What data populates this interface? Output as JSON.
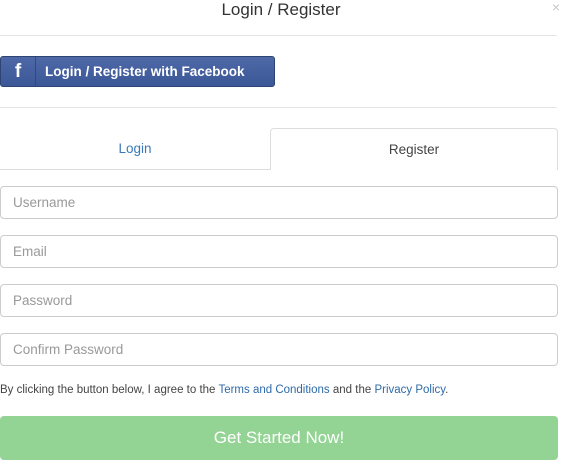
{
  "modal": {
    "title": "Login / Register",
    "close_glyph": "×"
  },
  "facebook": {
    "icon_glyph": "f",
    "label": "Login / Register with Facebook",
    "color": "#3b5797"
  },
  "tabs": [
    {
      "label": "Login",
      "active": false
    },
    {
      "label": "Register",
      "active": true
    }
  ],
  "fields": {
    "username": {
      "placeholder": "Username",
      "value": ""
    },
    "email": {
      "placeholder": "Email",
      "value": ""
    },
    "password": {
      "placeholder": "Password",
      "value": ""
    },
    "confirm_password": {
      "placeholder": "Confirm Password",
      "value": ""
    }
  },
  "terms": {
    "prefix": "By clicking the button below, I agree to the ",
    "terms_link": "Terms and Conditions",
    "middle": " and the ",
    "privacy_link": "Privacy Policy",
    "suffix": "."
  },
  "submit": {
    "label": "Get Started Now!",
    "color": "#93d393"
  }
}
